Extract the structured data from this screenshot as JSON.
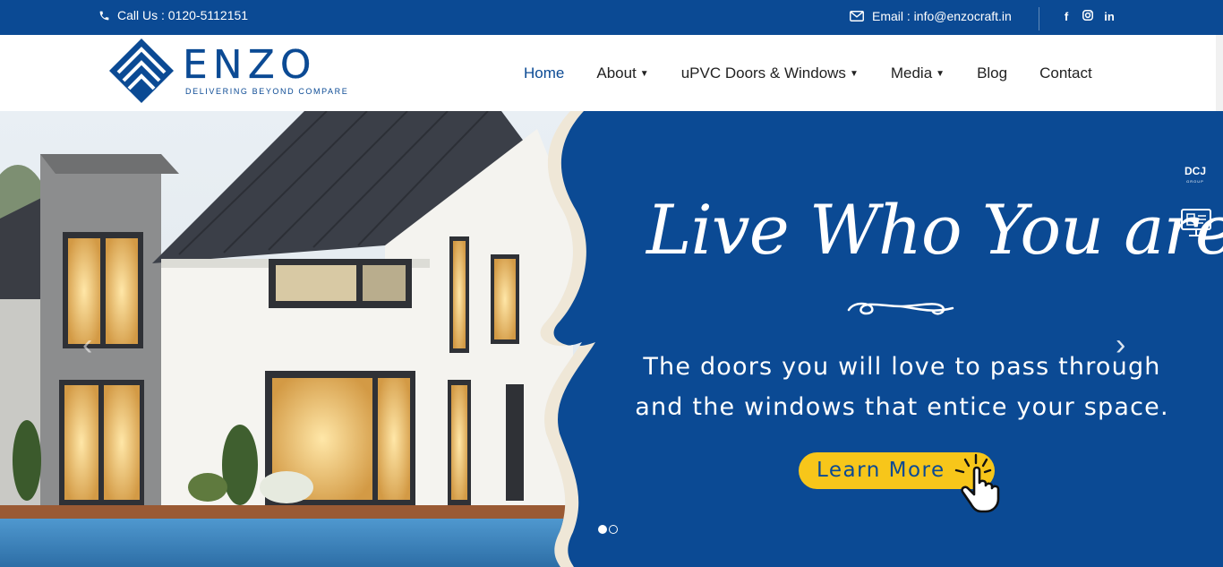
{
  "topbar": {
    "call": "Call Us : 0120-5112151",
    "email": "Email : info@enzocraft.in",
    "social": [
      "f",
      "in"
    ],
    "icons": [
      "phone-icon",
      "envelope-icon",
      "facebook-icon",
      "instagram-icon",
      "linkedin-icon"
    ]
  },
  "brand": {
    "name": "ENZO",
    "tagline": "DELIVERING BEYOND COMPARE",
    "color": "#0b4a94"
  },
  "nav": {
    "items": [
      {
        "label": "Home",
        "active": true
      },
      {
        "label": "About",
        "dropdown": true
      },
      {
        "label": "uPVC Doors & Windows",
        "dropdown": true
      },
      {
        "label": "Media",
        "dropdown": true
      },
      {
        "label": "Blog"
      },
      {
        "label": "Contact"
      }
    ]
  },
  "hero": {
    "heading": "Live Who You are",
    "subtext_line1": "The doors you will love to pass through",
    "subtext_line2": "and the windows that entice your space.",
    "cta": "Learn More",
    "slides_total": 2,
    "slide_active": 1,
    "prev_arrow": "‹",
    "next_arrow": "›",
    "accent_color": "#f7c61a"
  },
  "side": {
    "group_logo": "DCJ",
    "group_sub": "GROUP"
  }
}
